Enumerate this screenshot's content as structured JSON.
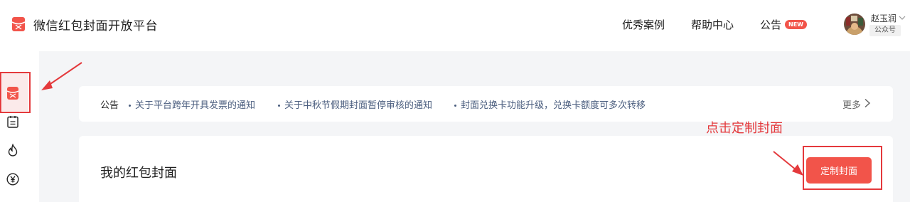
{
  "header": {
    "brand": "微信红包封面开放平台",
    "nav": [
      "优秀案例",
      "帮助中心",
      "公告"
    ],
    "new_badge": "NEW",
    "user": {
      "name": "赵玉润",
      "tag": "公众号"
    }
  },
  "sidebar": {
    "items": [
      "red-packet-icon",
      "clipboard-icon",
      "flame-icon",
      "yen-icon"
    ],
    "active_item": "red-packet-icon"
  },
  "annotations": {
    "red_note": "点击定制封面"
  },
  "notice": {
    "label": "公告",
    "items": [
      "关于平台跨年开具发票的通知",
      "关于中秋节假期封面暂停审核的通知",
      "封面兑换卡功能升级，兑换卡额度可多次转移"
    ],
    "more": "更多"
  },
  "main": {
    "title": "我的红包封面",
    "custom_button": "定制封面"
  },
  "colors": {
    "accent": "#f2544a",
    "annotation": "#e4393c",
    "link": "#4b5e7f",
    "background": "#f4f5f7"
  }
}
